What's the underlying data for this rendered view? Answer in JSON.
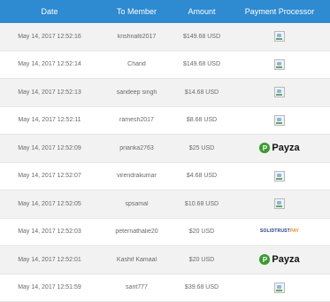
{
  "headers": {
    "date": "Date",
    "member": "To Member",
    "amount": "Amount",
    "processor": "Payment Processor"
  },
  "rows": [
    {
      "date": "May 14, 2017 12:52:16",
      "member": "krishnatti2017",
      "amount": "$149.68 USD",
      "processor": "broken-image-icon"
    },
    {
      "date": "May 14, 2017 12:52:14",
      "member": "Chand",
      "amount": "$149.68 USD",
      "processor": "broken-image-icon"
    },
    {
      "date": "May 14, 2017 12:52:13",
      "member": "sandeep singh",
      "amount": "$14.68 USD",
      "processor": "broken-image-icon"
    },
    {
      "date": "May 14, 2017 12:52:11",
      "member": "ramesh2017",
      "amount": "$8.68 USD",
      "processor": "broken-image-icon"
    },
    {
      "date": "May 14, 2017 12:52:09",
      "member": "prianka2763",
      "amount": "$25 USD",
      "processor": "payza-logo",
      "logo_text": "Payza"
    },
    {
      "date": "May 14, 2017 12:52:07",
      "member": "virendrakumar",
      "amount": "$4.68 USD",
      "processor": "broken-image-icon"
    },
    {
      "date": "May 14, 2017 12:52:05",
      "member": "spsamal",
      "amount": "$10.68 USD",
      "processor": "broken-image-icon"
    },
    {
      "date": "May 14, 2017 12:52:03",
      "member": "peternathalie20",
      "amount": "$20 USD",
      "processor": "solidtrustpay-logo",
      "logo_text": "SOLIDTRUSTPAY"
    },
    {
      "date": "May 14, 2017 12:52:01",
      "member": "Kashif Kamaal",
      "amount": "$20 USD",
      "processor": "payza-logo",
      "logo_text": "Payza"
    },
    {
      "date": "May 14, 2017 12:51:59",
      "member": "sarit777",
      "amount": "$39.68 USD",
      "processor": "broken-image-icon"
    }
  ],
  "colors": {
    "header_bg": "#2e8ad1",
    "header_text": "#ffffff",
    "alt_row_bg": "#f2f2f2",
    "payza_green": "#3a9c2e"
  }
}
